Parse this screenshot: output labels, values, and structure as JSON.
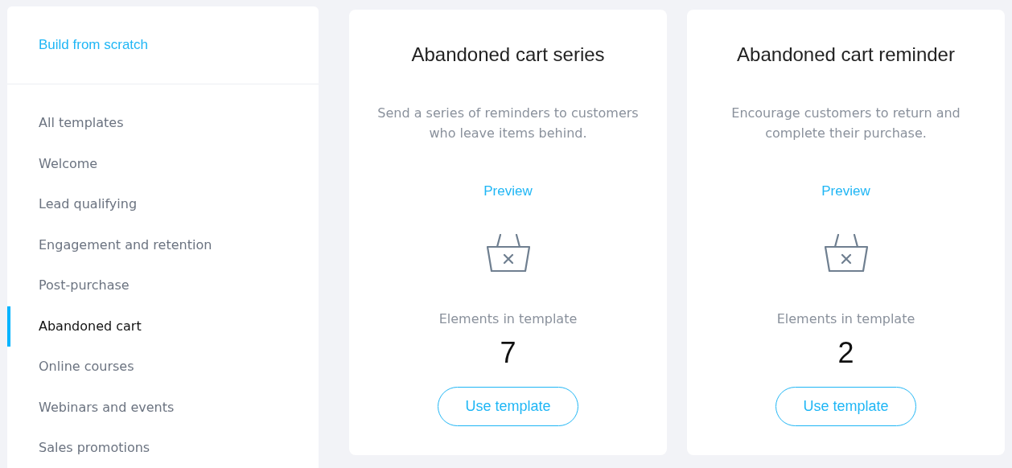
{
  "sidebar": {
    "build_link": "Build from scratch",
    "items": [
      {
        "label": "All templates",
        "selected": false
      },
      {
        "label": "Welcome",
        "selected": false
      },
      {
        "label": "Lead qualifying",
        "selected": false
      },
      {
        "label": "Engagement and retention",
        "selected": false
      },
      {
        "label": "Post-purchase",
        "selected": false
      },
      {
        "label": "Abandoned cart",
        "selected": true
      },
      {
        "label": "Online courses",
        "selected": false
      },
      {
        "label": "Webinars and events",
        "selected": false
      },
      {
        "label": "Sales promotions",
        "selected": false
      }
    ]
  },
  "templates": [
    {
      "title": "Abandoned cart series",
      "description": "Send a series of reminders to customers who leave items behind.",
      "preview": "Preview",
      "elements_label": "Elements in template",
      "elements_count": "7",
      "button": "Use template"
    },
    {
      "title": "Abandoned cart reminder",
      "description": "Encourage customers to return and complete their purchase.",
      "preview": "Preview",
      "elements_label": "Elements in template",
      "elements_count": "2",
      "button": "Use template"
    }
  ]
}
